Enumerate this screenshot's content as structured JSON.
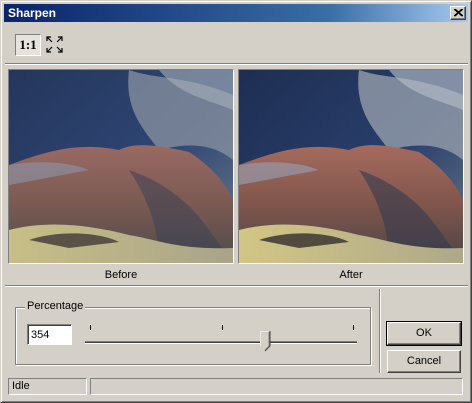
{
  "window": {
    "title": "Sharpen"
  },
  "toolbar": {
    "actual_size_label": "1:1",
    "fit_icon": "fit-to-window-icon"
  },
  "previews": {
    "before_label": "Before",
    "after_label": "After"
  },
  "percentage": {
    "group_label": "Percentage",
    "value": "354",
    "slider_fraction": 0.66,
    "tick_count": 3
  },
  "buttons": {
    "ok_label": "OK",
    "cancel_label": "Cancel"
  },
  "status": {
    "text": "Idle",
    "secondary": ""
  },
  "colors": {
    "title_start": "#0a246a",
    "title_end": "#a6caf0",
    "face": "#d4d0c8"
  }
}
